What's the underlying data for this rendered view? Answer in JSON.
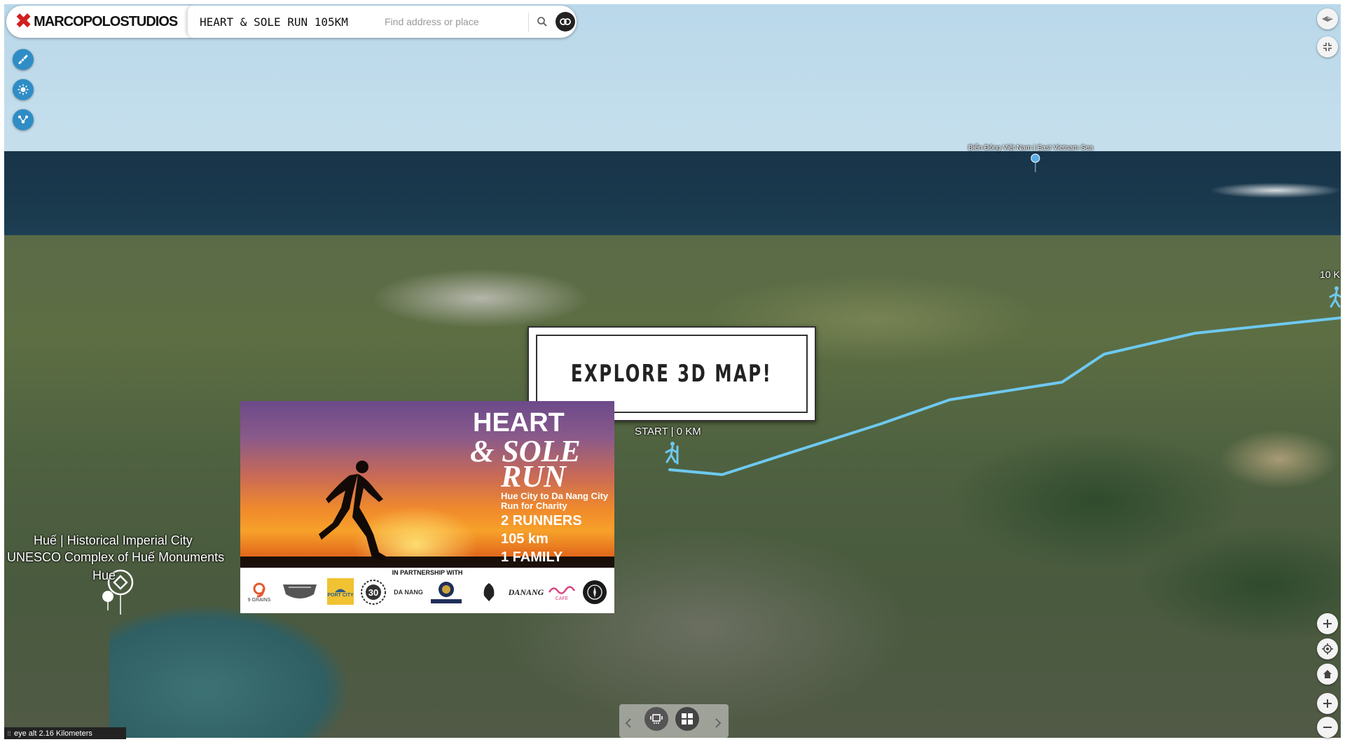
{
  "header": {
    "logo_text": "MARCOPOLOSTUDIOS",
    "map_title": "HEART & SOLE RUN 105KM",
    "search_placeholder": "Find address or place"
  },
  "map_labels": {
    "sea": "Biển Đông Việt Nam | East Vietnam Sea",
    "start": "START | 0 KM",
    "marker_10k": "10 K",
    "hue_line1": "Huế | Historical Imperial City",
    "hue_line2": "UNESCO Complex of Huế Monuments",
    "hue_city": "Hue"
  },
  "explore_button": "EXPLORE 3D MAP!",
  "poster": {
    "title_1": "HEART",
    "title_2": "& SOLE",
    "title_3": "RUN",
    "route_1": "Hue City to Da Nang City",
    "route_2": "Run for Charity",
    "stat_1": "2 RUNNERS",
    "stat_2": "105 km",
    "stat_3": "1 FAMILY",
    "partner_label": "IN PARTNERSHIP WITH",
    "partners": [
      "9 GRAINS",
      "PORT CITY",
      "DA NANG",
      "DANANG",
      "CAFE"
    ]
  },
  "status": {
    "eye_alt": "eye alt 2.16 Kilometers"
  },
  "colors": {
    "route": "#6ec9f0",
    "control_blue": "#2f8dc6",
    "logo_red": "#d21f1f"
  },
  "icons": {
    "left_tools": [
      "measure-icon",
      "daylight-icon",
      "share-network-icon"
    ],
    "top_right": [
      "compass-icon",
      "fullscreen-exit-icon"
    ],
    "right_nav": [
      "zoom-in-icon",
      "locate-icon",
      "home-icon",
      "zoom-in-icon",
      "zoom-out-icon"
    ],
    "bottom": [
      "prev-icon",
      "slides-icon",
      "gallery-icon",
      "next-icon"
    ]
  }
}
